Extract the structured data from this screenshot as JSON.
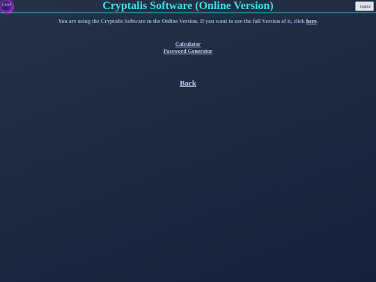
{
  "header": {
    "logo_icon": "cryptalis-logo-icon",
    "logo_text": "CSOF",
    "title": "Cryptalis Software (Online Version)",
    "logout_label": "Logout"
  },
  "notice": {
    "text_before": "You are using the Cryptalis Software in the Online Version. If you want to use the full Version of it, click ",
    "link_label": "here",
    "text_after": "."
  },
  "tools": {
    "items": [
      {
        "label": "Calculator"
      },
      {
        "label": "Password Generator"
      }
    ]
  },
  "back": {
    "label": "Back"
  },
  "colors": {
    "accent": "#3de0e8",
    "background": "#1d2a40",
    "link": "#b8c8ee"
  }
}
